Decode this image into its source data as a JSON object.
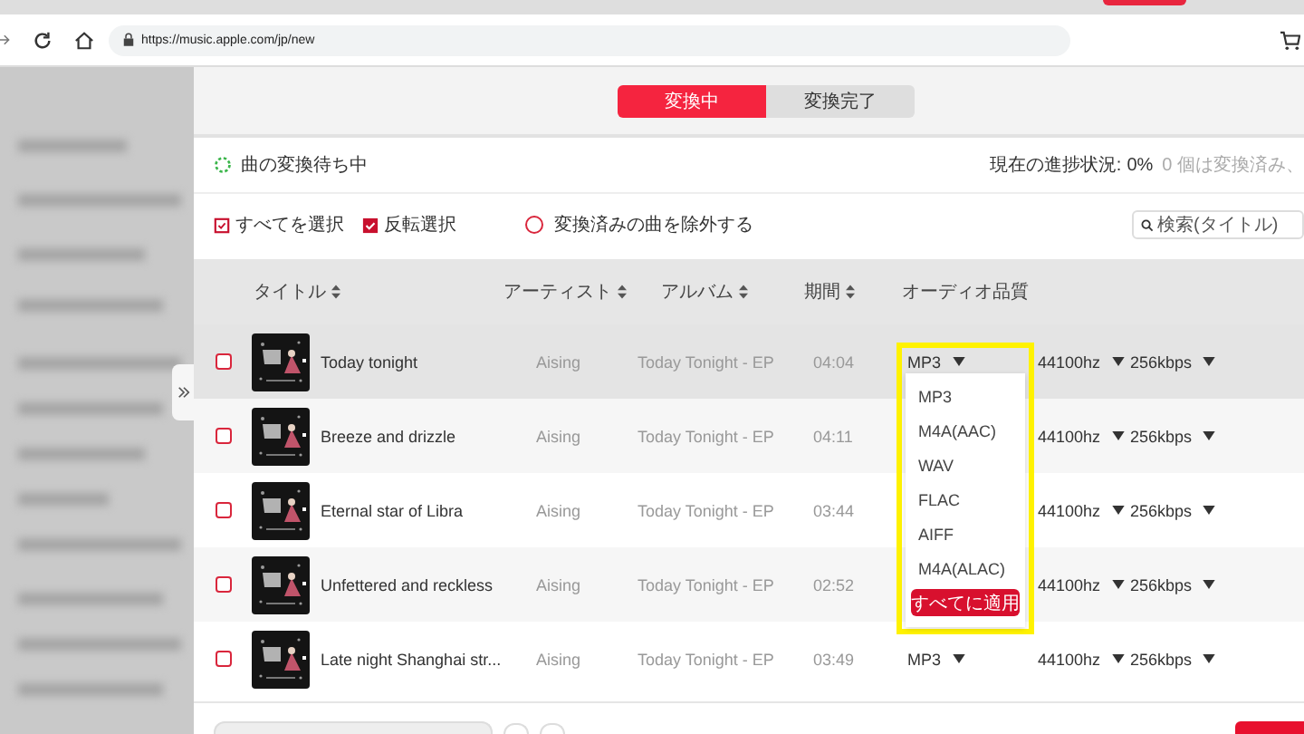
{
  "browser": {
    "url": "https://music.apple.com/jp/new"
  },
  "tabs": [
    {
      "label": "変換中",
      "selected": true
    },
    {
      "label": "変換完了",
      "selected": false
    }
  ],
  "status": {
    "waiting": "曲の変換待ち中",
    "progress_label": "現在の進捗状況:",
    "progress_value": "0%",
    "converted_note": "0 個は変換済み、"
  },
  "toolbar": {
    "select_all": "すべてを選択",
    "invert_selection": "反転選択",
    "exclude_converted": {
      "label": "変換済みの曲を除外する",
      "checked": false
    },
    "search": {
      "placeholder": "検索(タイトル)"
    }
  },
  "table": {
    "columns": [
      {
        "label": "タイトル",
        "sortable": true
      },
      {
        "label": "アーティスト",
        "sortable": true
      },
      {
        "label": "アルバム",
        "sortable": true
      },
      {
        "label": "期間",
        "sortable": true
      },
      {
        "label": "オーディオ品質",
        "sortable": false
      }
    ],
    "rows": [
      {
        "title": "Today tonight",
        "artist": "Aising",
        "album": "Today Tonight - EP",
        "duration": "04:04",
        "format": "MP3",
        "sample_rate": "44100hz",
        "bitrate": "256kbps",
        "checked": false,
        "hovered": true
      },
      {
        "title": "Breeze and drizzle",
        "artist": "Aising",
        "album": "Today Tonight - EP",
        "duration": "04:11",
        "sample_rate": "44100hz",
        "bitrate": "256kbps",
        "checked": false,
        "hovered": false
      },
      {
        "title": "Eternal star of Libra",
        "artist": "Aising",
        "album": "Today Tonight - EP",
        "duration": "03:44",
        "sample_rate": "44100hz",
        "bitrate": "256kbps",
        "checked": false,
        "hovered": false
      },
      {
        "title": "Unfettered and reckless",
        "artist": "Aising",
        "album": "Today Tonight - EP",
        "duration": "02:52",
        "sample_rate": "44100hz",
        "bitrate": "256kbps",
        "checked": false,
        "hovered": false
      },
      {
        "title": "Late night Shanghai str...",
        "artist": "Aising",
        "album": "Today Tonight - EP",
        "duration": "03:49",
        "format": "MP3",
        "sample_rate": "44100hz",
        "bitrate": "256kbps",
        "checked": false,
        "hovered": false
      }
    ]
  },
  "format_menu": {
    "options": [
      "MP3",
      "M4A(AAC)",
      "WAV",
      "FLAC",
      "AIFF",
      "M4A(ALAC)"
    ],
    "apply_button": "すべてに適用",
    "highlighted": true
  }
}
